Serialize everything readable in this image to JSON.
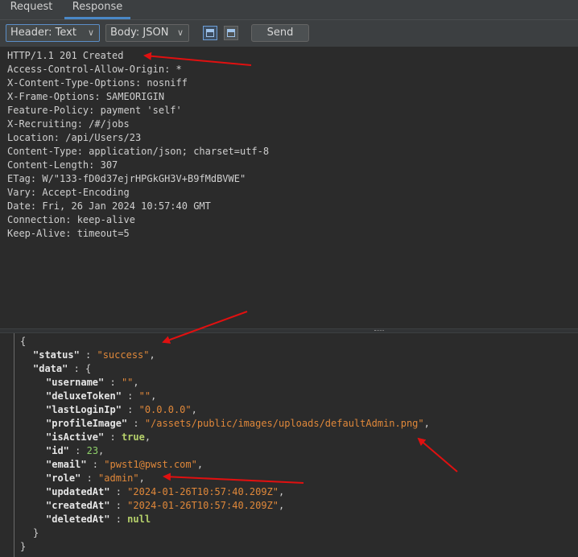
{
  "tabs": {
    "request": "Request",
    "response": "Response"
  },
  "toolbar": {
    "header_select": "Header: Text",
    "body_select": "Body: JSON",
    "send": "Send"
  },
  "headers": [
    "HTTP/1.1 201 Created",
    "Access-Control-Allow-Origin: *",
    "X-Content-Type-Options: nosniff",
    "X-Frame-Options: SAMEORIGIN",
    "Feature-Policy: payment 'self'",
    "X-Recruiting: /#/jobs",
    "Location: /api/Users/23",
    "Content-Type: application/json; charset=utf-8",
    "Content-Length: 307",
    "ETag: W/\"133-fD0d37ejrHPGkGH3V+B9fMdBVWE\"",
    "Vary: Accept-Encoding",
    "Date: Fri, 26 Jan 2024 10:57:40 GMT",
    "Connection: keep-alive",
    "Keep-Alive: timeout=5"
  ],
  "json": {
    "open_brace": "{",
    "status_key": "\"status\"",
    "status_val": "\"success\"",
    "data_key": "\"data\"",
    "username_key": "\"username\"",
    "username_val": "\"\"",
    "deluxeToken_key": "\"deluxeToken\"",
    "deluxeToken_val": "\"\"",
    "lastLoginIp_key": "\"lastLoginIp\"",
    "lastLoginIp_val": "\"0.0.0.0\"",
    "profileImage_key": "\"profileImage\"",
    "profileImage_val": "\"/assets/public/images/uploads/defaultAdmin.png\"",
    "isActive_key": "\"isActive\"",
    "isActive_val": "true",
    "id_key": "\"id\"",
    "id_val": "23",
    "email_key": "\"email\"",
    "email_val": "\"pwst1@pwst.com\"",
    "role_key": "\"role\"",
    "role_val": "\"admin\"",
    "updatedAt_key": "\"updatedAt\"",
    "updatedAt_val": "\"2024-01-26T10:57:40.209Z\"",
    "createdAt_key": "\"createdAt\"",
    "createdAt_val": "\"2024-01-26T10:57:40.209Z\"",
    "deletedAt_key": "\"deletedAt\"",
    "deletedAt_val": "null",
    "close_inner": "}",
    "close_outer": "}"
  },
  "colors": {
    "arrow": "#e01010",
    "string": "#e0883a",
    "number": "#8fd16a",
    "accent": "#4a88c7"
  }
}
